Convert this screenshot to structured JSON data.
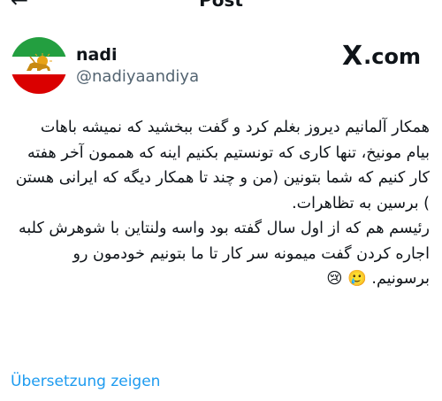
{
  "header": {
    "title": "Post",
    "back_icon": "arrow-left-icon",
    "more_icon": "more-dots-icon"
  },
  "author": {
    "name": "nadi",
    "handle": "@nadiyaandiya",
    "avatar": "lion-and-sun-flag-avatar"
  },
  "brand": {
    "logo": "X",
    "text": ".com"
  },
  "tweet": {
    "paragraph1": "همکار آلمانیم دیروز بغلم کرد و گفت ببخشید که نمیشه باهات بیام مونیخ، تنها کاری که تونستیم بکنیم اینه که هممون آخر هفته کار کنیم که شما بتونین (من و چند تا همکار دیگه که ایرانی هستن ) برسین به تظاهرات.",
    "paragraph2": "رئیسم هم که از اول سال گفته بود واسه ولنتاین با شوهرش کلبه اجاره کردن گفت میمونه سر کار تا ما بتونیم خودمون رو برسونیم. 🥲 😢"
  },
  "translate_link": "Übersetzung zeigen",
  "colors": {
    "link": "#1d9bf0",
    "secondary_text": "#536471",
    "primary_text": "#0f1419",
    "flag_green": "#239f40",
    "flag_white": "#ffffff",
    "flag_red": "#da0000"
  }
}
